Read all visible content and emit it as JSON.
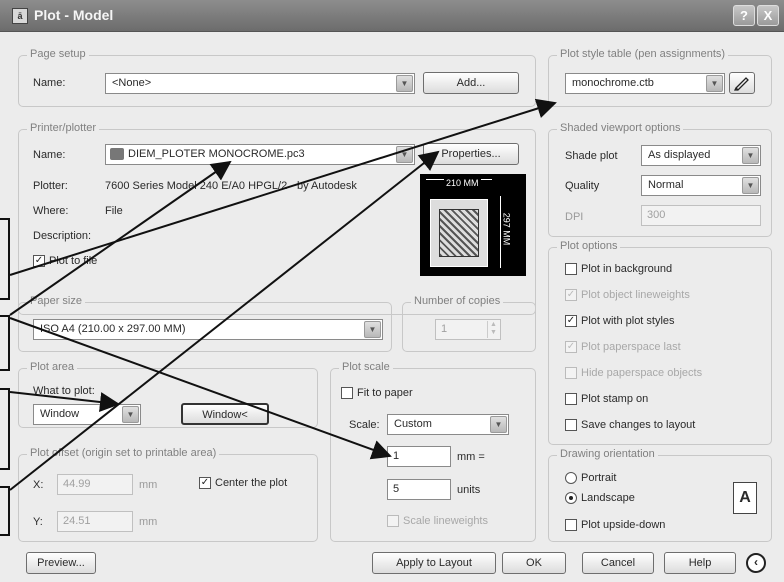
{
  "window": {
    "title": "Plot - Model",
    "app_icon_text": "ā",
    "help_button": "?",
    "close_button": "X"
  },
  "page_setup": {
    "group_label": "Page setup",
    "name_label": "Name:",
    "name_value": "<None>",
    "add_button": "Add..."
  },
  "printer": {
    "group_label": "Printer/plotter",
    "name_label": "Name:",
    "name_value": "DIEM_PLOTER MONOCROME.pc3",
    "properties_button": "Properties...",
    "plotter_label": "Plotter:",
    "plotter_value": "7600 Series Model 240 E/A0 HPGL/2 - by Autodesk",
    "where_label": "Where:",
    "where_value": "File",
    "description_label": "Description:",
    "plot_to_file_label": "Plot to file",
    "plot_to_file_checked": true,
    "preview_width_text": "210 MM",
    "preview_height_text": "297 MM"
  },
  "paper_size": {
    "group_label": "Paper size",
    "value": "ISO A4 (210.00 x 297.00 MM)"
  },
  "copies": {
    "group_label": "Number of copies",
    "value": "1"
  },
  "plot_area": {
    "group_label": "Plot area",
    "what_label": "What to plot:",
    "what_value": "Window",
    "window_button": "Window<"
  },
  "plot_offset": {
    "group_label": "Plot offset (origin set to printable area)",
    "x_label": "X:",
    "x_value": "44.99",
    "x_unit": "mm",
    "y_label": "Y:",
    "y_value": "24.51",
    "y_unit": "mm",
    "center_label": "Center the plot",
    "center_checked": true
  },
  "plot_scale": {
    "group_label": "Plot scale",
    "fit_label": "Fit to paper",
    "fit_checked": false,
    "scale_label": "Scale:",
    "scale_value": "Custom",
    "mm_value": "1",
    "mm_unit": "mm =",
    "units_value": "5",
    "units_unit": "units",
    "lineweights_label": "Scale lineweights"
  },
  "style_table": {
    "group_label": "Plot style table (pen assignments)",
    "value": "monochrome.ctb",
    "edit_icon": "pen-edit-icon"
  },
  "shaded": {
    "group_label": "Shaded viewport options",
    "shade_label": "Shade plot",
    "shade_value": "As displayed",
    "quality_label": "Quality",
    "quality_value": "Normal",
    "dpi_label": "DPI",
    "dpi_value": "300"
  },
  "plot_options": {
    "group_label": "Plot options",
    "items": [
      {
        "label": "Plot in background",
        "checked": false,
        "enabled": true
      },
      {
        "label": "Plot object lineweights",
        "checked": true,
        "enabled": false
      },
      {
        "label": "Plot with plot styles",
        "checked": true,
        "enabled": true
      },
      {
        "label": "Plot paperspace last",
        "checked": true,
        "enabled": false
      },
      {
        "label": "Hide paperspace objects",
        "checked": false,
        "enabled": false
      },
      {
        "label": "Plot stamp on",
        "checked": false,
        "enabled": true
      },
      {
        "label": "Save changes to layout",
        "checked": false,
        "enabled": true
      }
    ]
  },
  "orientation": {
    "group_label": "Drawing orientation",
    "portrait_label": "Portrait",
    "landscape_label": "Landscape",
    "selected": "Landscape",
    "upside_label": "Plot upside-down",
    "upside_checked": false,
    "preview_letter": "A"
  },
  "footer": {
    "preview_button": "Preview...",
    "apply_button": "Apply to Layout",
    "ok_button": "OK",
    "cancel_button": "Cancel",
    "help_button": "Help",
    "more_icon": "chevron-left-circle-icon"
  },
  "colors": {
    "titlebar": "#7a7a7a",
    "dialog_bg": "#ececec",
    "annotation": "#111111"
  }
}
